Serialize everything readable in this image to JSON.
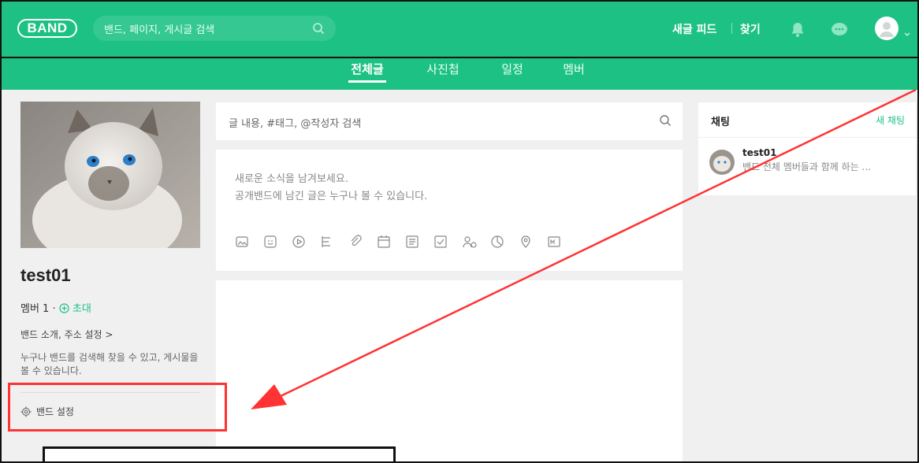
{
  "header": {
    "logo": "BAND",
    "search_placeholder": "밴드, 페이지, 게시글 검색",
    "new_feed": "새글 피드",
    "find": "찾기"
  },
  "tabs": [
    {
      "label": "전체글",
      "active": true
    },
    {
      "label": "사진첩",
      "active": false
    },
    {
      "label": "일정",
      "active": false
    },
    {
      "label": "멤버",
      "active": false
    }
  ],
  "band": {
    "name": "test01",
    "members_label": "멤버 1 ·",
    "invite_label": "초대",
    "intro_link": "밴드 소개, 주소 설정 >",
    "description": "누구나 밴드를 검색해 찾을 수 있고, 게시물을 볼 수 있습니다.",
    "settings_label": "밴드 설정"
  },
  "post": {
    "search_placeholder": "글 내용, #태그, @작성자 검색",
    "compose_line1": "새로운 소식을 남겨보세요.",
    "compose_line2": "공개밴드에 남긴 글은 누구나 볼 수 있습니다.",
    "tools": [
      "image-icon",
      "sticker-icon",
      "video-icon",
      "file-list-icon",
      "attach-icon",
      "calendar-icon",
      "board-icon",
      "todo-icon",
      "participants-icon",
      "chart-icon",
      "location-icon",
      "more-icon"
    ]
  },
  "chat": {
    "title": "채팅",
    "new_chat": "새 채팅",
    "items": [
      {
        "name": "test01",
        "message": "밴드 전체 멤버들과 함께 하는 ..."
      }
    ]
  },
  "colors": {
    "brand": "#1ec184",
    "annotation_red": "#ff3333"
  }
}
